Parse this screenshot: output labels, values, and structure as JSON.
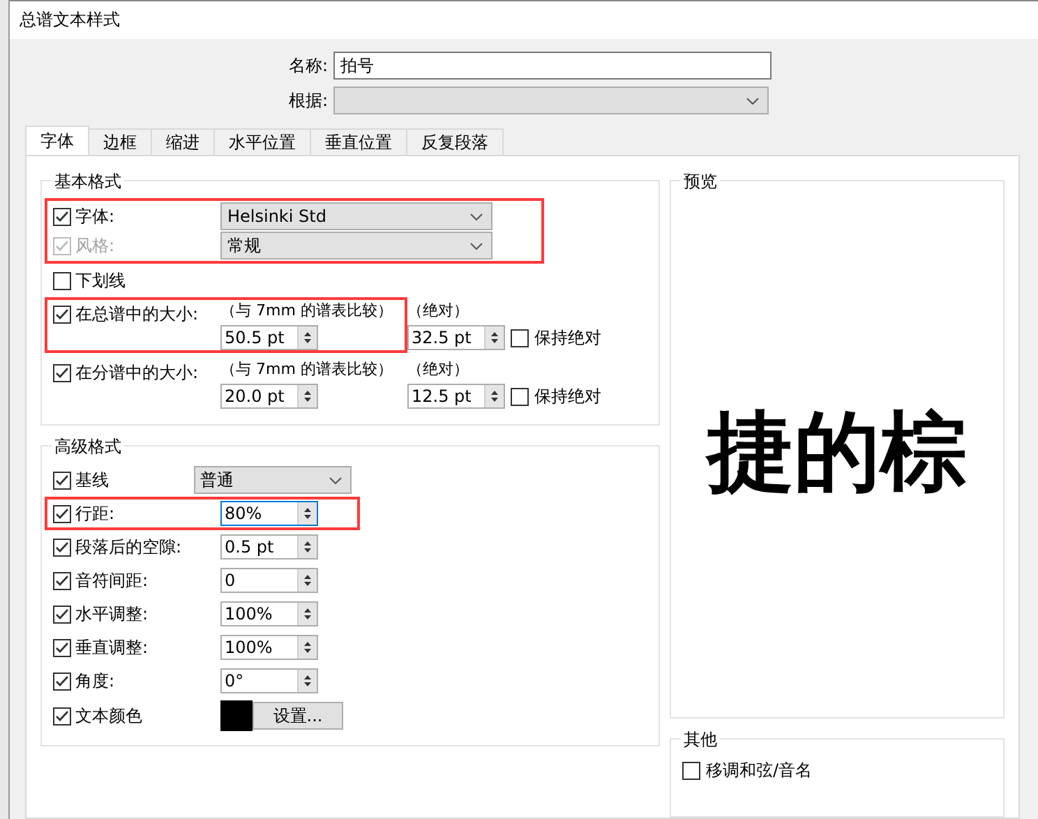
{
  "window": {
    "title": "总谱文本样式"
  },
  "name_field": {
    "label": "名称:",
    "value": "拍号"
  },
  "based_on": {
    "label": "根据:",
    "disabled": true
  },
  "tabs": [
    {
      "label": "字体",
      "selected": true
    },
    {
      "label": "边框",
      "selected": false
    },
    {
      "label": "缩进",
      "selected": false
    },
    {
      "label": "水平位置",
      "selected": false
    },
    {
      "label": "垂直位置",
      "selected": false
    },
    {
      "label": "反复段落",
      "selected": false
    }
  ],
  "basic_format": {
    "title": "基本格式",
    "rows": [
      {
        "kind": "dropdown",
        "label": "字体:",
        "checked": true,
        "disabled": false,
        "value": "Helsinki Std",
        "highlighted": true
      },
      {
        "kind": "dropdown",
        "label": "风格:",
        "checked": true,
        "disabled": true,
        "value": "常规",
        "highlighted": true
      },
      {
        "kind": "check",
        "label": "下划线",
        "checked": false,
        "highlighted": false
      },
      {
        "kind": "size",
        "label": "在总谱中的大小:",
        "checked": true,
        "relative_caption": "（与 7mm 的谱表比较）",
        "absolute_caption": "（绝对）",
        "relative": "50.5 pt",
        "absolute": "32.5 pt",
        "keep_label": "保持绝对",
        "keep_checked": false,
        "highlighted": true
      },
      {
        "kind": "size",
        "label": "在分谱中的大小:",
        "checked": true,
        "relative_caption": "（与 7mm 的谱表比较）",
        "absolute_caption": "（绝对）",
        "relative": "20.0 pt",
        "absolute": "12.5 pt",
        "keep_label": "保持绝对",
        "keep_checked": false,
        "highlighted": false
      }
    ]
  },
  "advanced_format": {
    "title": "高级格式",
    "rows": [
      {
        "kind": "dropdown",
        "label": "基线",
        "checked": true,
        "value": "普通",
        "highlighted": false
      },
      {
        "kind": "spinner",
        "label": "行距:",
        "checked": true,
        "value": "80%",
        "focused": true,
        "highlighted": true
      },
      {
        "kind": "spinner",
        "label": "段落后的空隙:",
        "checked": true,
        "value": "0.5 pt",
        "focused": false,
        "highlighted": false
      },
      {
        "kind": "spinner",
        "label": "音符间距:",
        "checked": true,
        "value": "0",
        "focused": false,
        "highlighted": false
      },
      {
        "kind": "spinner",
        "label": "水平调整:",
        "checked": true,
        "value": "100%",
        "focused": false,
        "highlighted": false
      },
      {
        "kind": "spinner",
        "label": "垂直调整:",
        "checked": true,
        "value": "100%",
        "focused": false,
        "highlighted": false
      },
      {
        "kind": "spinner",
        "label": "角度:",
        "checked": true,
        "value": "0°",
        "focused": false,
        "highlighted": false
      },
      {
        "kind": "color",
        "label": "文本颜色",
        "checked": true,
        "color": "#000000",
        "button": "设置...",
        "highlighted": false
      }
    ]
  },
  "preview": {
    "title": "预览",
    "sample": "捷的棕"
  },
  "other": {
    "title": "其他",
    "options": [
      {
        "label": "移调和弦/音名",
        "checked": false
      }
    ]
  }
}
